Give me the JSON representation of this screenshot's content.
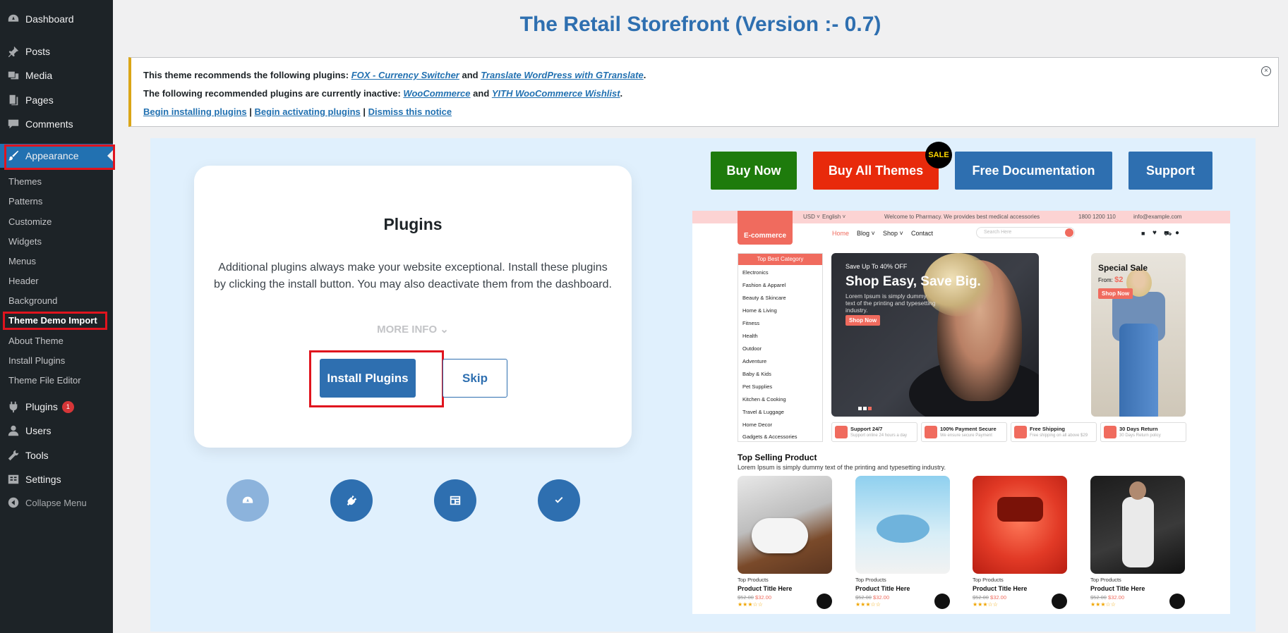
{
  "sidebar": {
    "items": [
      {
        "label": "Dashboard",
        "icon": "dashboard-icon"
      },
      {
        "label": "Posts",
        "icon": "pin-icon"
      },
      {
        "label": "Media",
        "icon": "media-icon"
      },
      {
        "label": "Pages",
        "icon": "pages-icon"
      },
      {
        "label": "Comments",
        "icon": "comment-icon"
      },
      {
        "label": "Appearance",
        "icon": "brush-icon"
      }
    ],
    "submenu": [
      "Themes",
      "Patterns",
      "Customize",
      "Widgets",
      "Menus",
      "Header",
      "Background",
      "Theme Demo Import",
      "About Theme",
      "Install Plugins",
      "Theme File Editor"
    ],
    "lower": [
      {
        "label": "Plugins",
        "icon": "plug-icon",
        "badge": "1"
      },
      {
        "label": "Users",
        "icon": "user-icon"
      },
      {
        "label": "Tools",
        "icon": "wrench-icon"
      },
      {
        "label": "Settings",
        "icon": "settings-icon"
      },
      {
        "label": "Collapse Menu",
        "icon": "collapse-icon"
      }
    ]
  },
  "page_title": "The Retail Storefront (Version :- 0.7)",
  "notice": {
    "line1_pre": "This theme recommends the following plugins: ",
    "line1_link1": "FOX - Currency Switcher",
    "line1_and": " and ",
    "line1_link2": "Translate WordPress with GTranslate",
    "line1_end": ".",
    "line2_pre": "The following recommended plugins are currently inactive: ",
    "line2_link1": "WooCommerce",
    "line2_and": " and ",
    "line2_link2": "YITH WooCommerce Wishlist",
    "line2_end": ".",
    "action1": "Begin installing plugins",
    "sep": " | ",
    "action2": "Begin activating plugins",
    "action3": "Dismiss this notice",
    "close": "×"
  },
  "card": {
    "title": "Plugins",
    "description": "Additional plugins always make your website exceptional. Install these plugins by clicking the install button. You may also deactivate them from the dashboard.",
    "more_info": "MORE INFO ⌄",
    "install_label": "Install Plugins",
    "skip_label": "Skip"
  },
  "steps": [
    "speedometer-icon",
    "plug-icon",
    "layout-icon",
    "check-icon"
  ],
  "buttons": {
    "buy_now": "Buy Now",
    "buy_all": "Buy All Themes",
    "sale": "SALE",
    "docs": "Free Documentation",
    "support": "Support"
  },
  "colors": {
    "accent": "#2e6fb0",
    "buy_now": "#1e7b0c",
    "buy_all": "#e82a0b",
    "highlight": "#e0141e"
  },
  "preview": {
    "topbar": {
      "currency": "USD ˅",
      "lang": "English ˅",
      "welcome": "Welcome to Pharmacy. We provides best medical accessories",
      "phone": "1800 1200 110",
      "email": "info@example.com"
    },
    "logo": "E-commerce",
    "nav": [
      "Home",
      "Blog ˅",
      "Shop ˅",
      "Contact"
    ],
    "search_placeholder": "Search Here",
    "category_title": "Top Best Category",
    "categories": [
      "Electronics",
      "Fashion & Apparel",
      "Beauty & Skincare",
      "Home & Living",
      "Fitness",
      "Health",
      "Outdoor",
      "Adventure",
      "Baby & Kids",
      "Pet Supplies",
      "Kitchen & Cooking",
      "Travel & Luggage",
      "Home Decor",
      "Gadgets & Accessories"
    ],
    "hero": {
      "small": "Save Up To 40% OFF",
      "big": "Shop Easy, Save Big.",
      "desc": "Lorem Ipsum is simply dummy text of the printing and typesetting industry.",
      "btn": "Shop Now"
    },
    "special": {
      "title": "Special Sale",
      "from": "From:",
      "price": "$2",
      "btn": "Shop Now"
    },
    "features": [
      {
        "title": "Support 24/7",
        "sub": "Support online 24 hours a day"
      },
      {
        "title": "100% Payment Secure",
        "sub": "We ensure secure Payment"
      },
      {
        "title": "Free Shipping",
        "sub": "Free shipping on all above $29"
      },
      {
        "title": "30 Days Return",
        "sub": "30 Days Return policy"
      }
    ],
    "top_title": "Top Selling Product",
    "top_sub": "Lorem Ipsum is simply dummy text of the printing and typesetting industry.",
    "products": [
      {
        "cat": "Top Products",
        "title": "Product Title Here",
        "old": "$52.00",
        "new": "$32.00",
        "stars": "★★★☆☆"
      },
      {
        "cat": "Top Products",
        "title": "Product Title Here",
        "old": "$52.00",
        "new": "$32.00",
        "stars": "★★★☆☆"
      },
      {
        "cat": "Top Products",
        "title": "Product Title Here",
        "old": "$52.00",
        "new": "$32.00",
        "stars": "★★★☆☆"
      },
      {
        "cat": "Top Products",
        "title": "Product Title Here",
        "old": "$52.00",
        "new": "$32.00",
        "stars": "★★★☆☆"
      }
    ]
  }
}
